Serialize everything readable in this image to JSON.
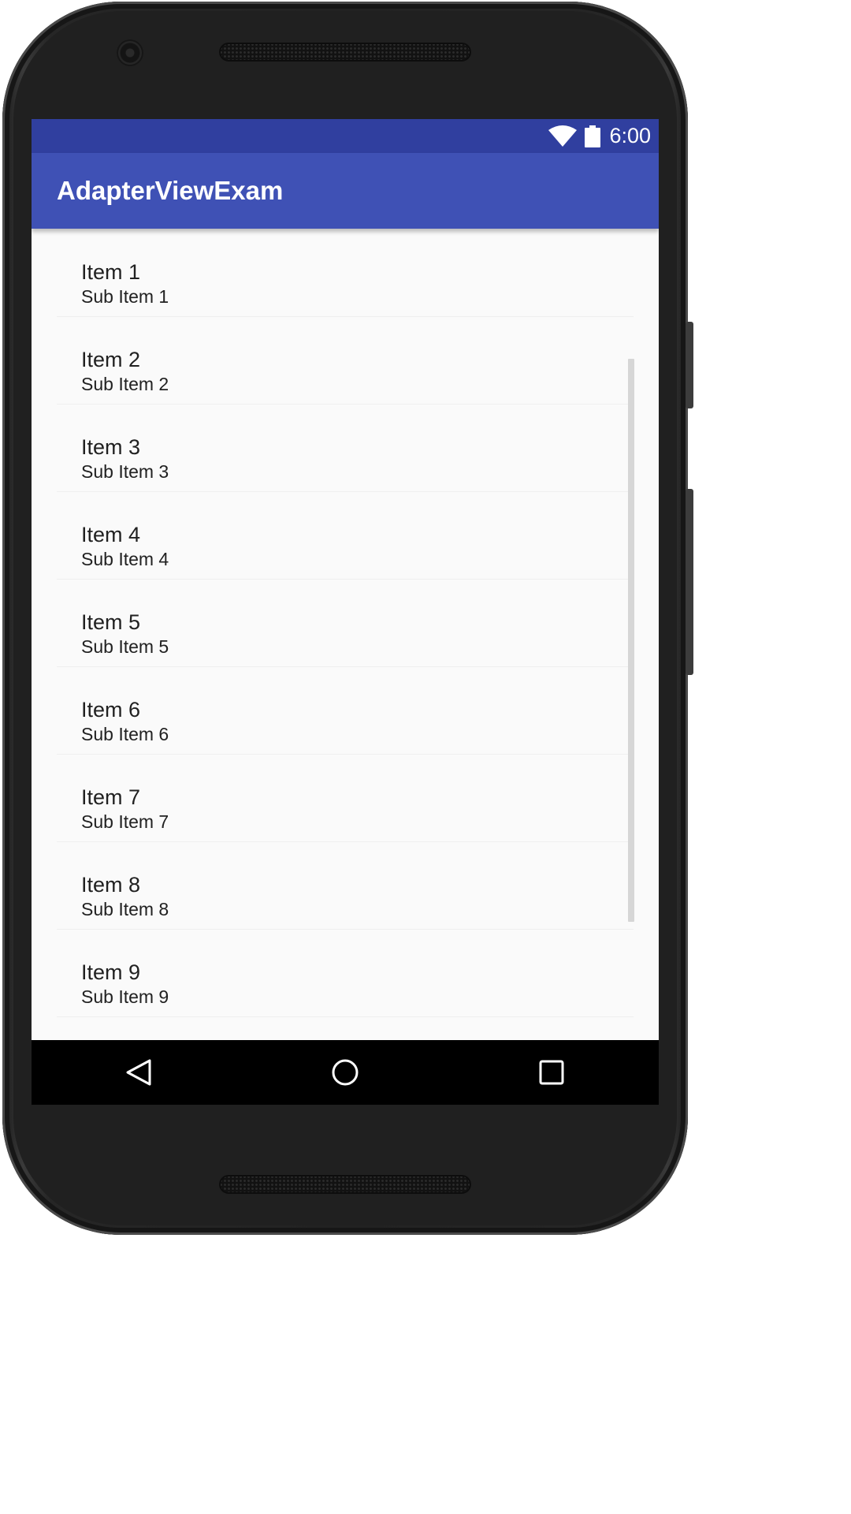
{
  "status_bar": {
    "time": "6:00",
    "icons": [
      "wifi-icon",
      "battery-icon"
    ]
  },
  "app_bar": {
    "title": "AdapterViewExam"
  },
  "list": {
    "items": [
      {
        "title": "Item 1",
        "subtitle": "Sub Item 1"
      },
      {
        "title": "Item 2",
        "subtitle": "Sub Item 2"
      },
      {
        "title": "Item 3",
        "subtitle": "Sub Item 3"
      },
      {
        "title": "Item 4",
        "subtitle": "Sub Item 4"
      },
      {
        "title": "Item 5",
        "subtitle": "Sub Item 5"
      },
      {
        "title": "Item 6",
        "subtitle": "Sub Item 6"
      },
      {
        "title": "Item 7",
        "subtitle": "Sub Item 7"
      },
      {
        "title": "Item 8",
        "subtitle": "Sub Item 8"
      },
      {
        "title": "Item 9",
        "subtitle": "Sub Item 9"
      }
    ]
  },
  "nav_bar": {
    "buttons": [
      "back-icon",
      "home-icon",
      "recents-icon"
    ]
  },
  "colors": {
    "status_bar": "#303f9f",
    "app_bar": "#3f51b5",
    "list_background": "#fafafa",
    "text": "#212121",
    "nav_bar": "#000000"
  }
}
